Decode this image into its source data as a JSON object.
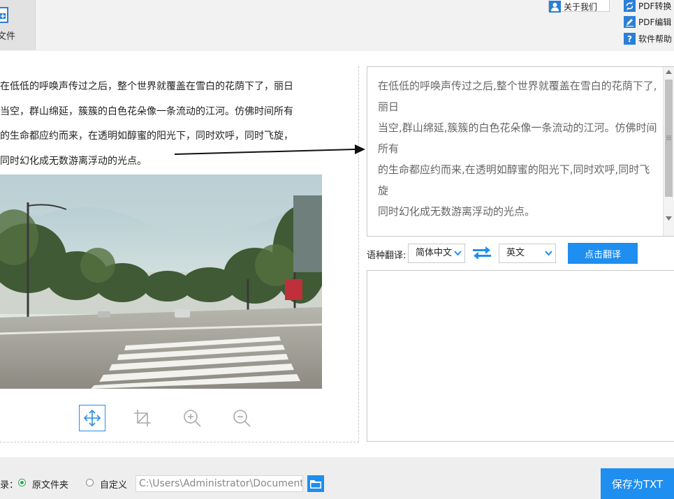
{
  "toolbar": {
    "open_file_label": "文件",
    "about_label": "关于我们",
    "pdf_convert_label": "PDF转换",
    "pdf_edit_label": "PDF编辑",
    "help_label": "软件帮助"
  },
  "source": {
    "lines": [
      "在低低的呼唤声传过之后，整个世界就覆盖在雪白的花荫下了，丽日",
      "当空，群山绵延，簇簇的白色花朵像一条流动的江河。仿佛时间所有",
      "的生命都应约而来，在透明如醇蜜的阳光下，同时欢呼，同时飞旋，",
      "同时幻化成无数游离浮动的光点。"
    ]
  },
  "recognized": {
    "lines": [
      "在低低的呼唤声传过之后,整个世界就覆盖在雪白的花荫下了,丽日",
      "当空,群山绵延,簇簇的白色花朵像一条流动的江河。仿佛时间所有",
      "的生命都应约而来,在透明如醇蜜的阳光下,同时欢呼,同时飞旋",
      "同时幻化成无数游离浮动的光点。"
    ]
  },
  "translate": {
    "label": "语种翻译:",
    "source_lang": "简体中文",
    "target_lang": "英文",
    "button": "点击翻译"
  },
  "image_tools": [
    "move-icon",
    "crop-icon",
    "zoom-in-icon",
    "zoom-out-icon"
  ],
  "bottom": {
    "dir_label": "录：",
    "option_original": "原文件夹",
    "option_custom": "自定义",
    "path_value": "C:\\Users\\Administrator\\Documents",
    "save_button": "保存为TXT"
  },
  "colors": {
    "accent": "#1e8ef0",
    "radio_checked": "#2ca65a"
  }
}
